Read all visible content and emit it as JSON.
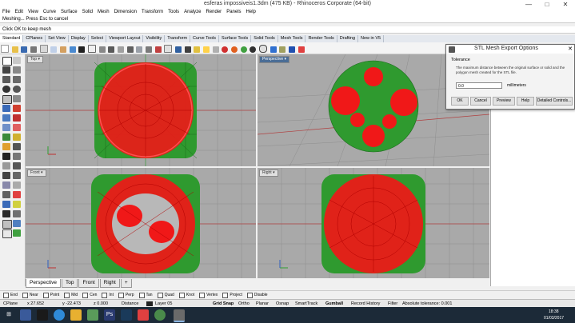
{
  "window": {
    "title": "esferas impossiveis1.3dm (475 KB) - Rhinoceros Corporate (64-bit)",
    "minimize": "—",
    "maximize": "□",
    "close": "✕"
  },
  "menu": [
    "File",
    "Edit",
    "View",
    "Curve",
    "Surface",
    "Solid",
    "Mesh",
    "Dimension",
    "Transform",
    "Tools",
    "Analyze",
    "Render",
    "Panels",
    "Help"
  ],
  "command": {
    "history": "Meshing... Press Esc to cancel",
    "prompt": "Click OK to keep mesh"
  },
  "toolbar_tabs": [
    "Standard",
    "CPlanes",
    "Set View",
    "Display",
    "Select",
    "Viewport Layout",
    "Visibility",
    "Transform",
    "Curve Tools",
    "Surface Tools",
    "Solid Tools",
    "Mesh Tools",
    "Render Tools",
    "Drafting",
    "New in V5"
  ],
  "viewports": {
    "top": "Top",
    "perspective": "Perspective",
    "front": "Front",
    "right": "Right"
  },
  "viewport_tabs": [
    "Perspective",
    "Top",
    "Front",
    "Right",
    "+"
  ],
  "osnap": [
    "End",
    "Near",
    "Point",
    "Mid",
    "Cen",
    "Int",
    "Perp",
    "Tan",
    "Quad",
    "Knot",
    "Vertex",
    "Project",
    "Disable"
  ],
  "status": {
    "cplane": "CPlane",
    "x": "x 27.652",
    "y": "y -22.473",
    "z": "z 0.000",
    "units": "Distance",
    "layer": "Layer 05",
    "grid_snap": "Grid Snap",
    "ortho": "Ortho",
    "planar": "Planar",
    "osnap": "Osnap",
    "smarttrack": "SmartTrack",
    "gumball": "Gumball",
    "record_history": "Record History",
    "filter": "Filter",
    "tolerance": "Absolute tolerance: 0.001"
  },
  "dialog": {
    "title": "STL Mesh Export Options",
    "group": "Tolerance",
    "description": "The maximum distance between the original surface or solid and the polygon mesh created for the STL file.",
    "value": "0.0",
    "units": "millimeters",
    "ok": "OK",
    "cancel": "Cancel",
    "preview": "Preview",
    "help": "Help",
    "detailed": "Detailed Controls..."
  },
  "taskbar": {
    "time": "18:38",
    "date": "01/03/2017"
  },
  "colors": {
    "mesh_green": "#2f9a2f",
    "mesh_red": "#f01818",
    "viewport_bg": "#a9a9a9",
    "active_label": "#4a6d96"
  }
}
